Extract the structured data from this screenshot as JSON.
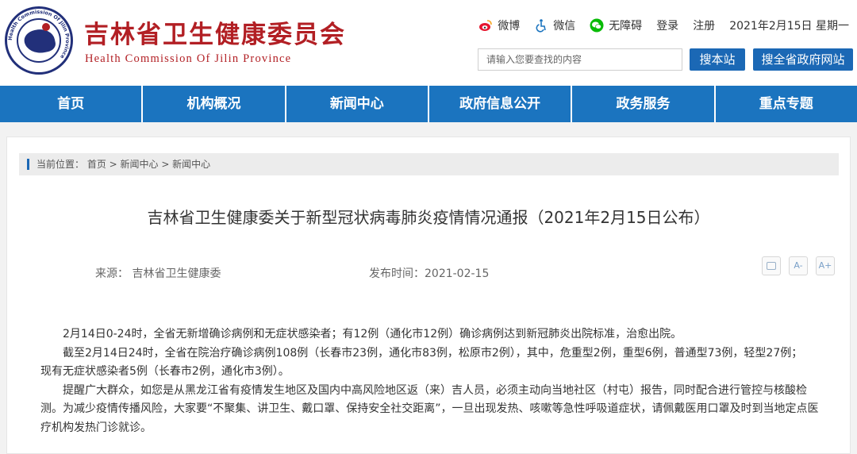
{
  "header": {
    "title": "吉林省卫生健康委员会",
    "subtitle": "Health Commission Of Jilin Province",
    "logo_text": "Health Commission Of Jilin Province",
    "links": {
      "weibo": "微博",
      "weixin": "微信",
      "accessibility": "无障碍",
      "login": "登录",
      "register": "注册",
      "date": "2021年2月15日 星期一"
    },
    "search": {
      "placeholder": "请输入您要查找的内容",
      "site_button": "搜本站",
      "all_button": "搜全省政府网站"
    }
  },
  "nav": [
    "首页",
    "机构概况",
    "新闻中心",
    "政府信息公开",
    "政务服务",
    "重点专题"
  ],
  "breadcrumb": "当前位置： 首页 > 新闻中心 > 新闻中心",
  "article": {
    "title": "吉林省卫生健康委关于新型冠状病毒肺炎疫情情况通报（2021年2月15日公布）",
    "source": "来源： 吉林省卫生健康委",
    "published": "发布时间：2021-02-15",
    "font_minus": "A-",
    "font_plus": "A+",
    "paragraphs": [
      "2月14日0-24时，全省无新增确诊病例和无症状感染者；有12例（通化市12例）确诊病例达到新冠肺炎出院标准，治愈出院。",
      "截至2月14日24时，全省在院治疗确诊病例108例（长春市23例，通化市83例，松原市2例），其中，危重型2例，重型6例，普通型73例，轻型27例；",
      "现有无症状感染者5例（长春市2例，通化市3例）。",
      "提醒广大群众，如您是从黑龙江省有疫情发生地区及国内中高风险地区返（来）吉人员，必须主动向当地社区（村屯）报告，同时配合进行管控与核酸检测。为减少疫情传播风险，大家要“不聚集、讲卫生、戴口罩、保持安全社交距离”，一旦出现发热、咳嗽等急性呼吸道症状，请佩戴医用口罩及时到当地定点医疗机构发热门诊就诊。"
    ]
  },
  "colors": {
    "brand_red": "#b21f24",
    "nav_blue": "#1b74bf",
    "button_blue": "#1b68b5"
  }
}
